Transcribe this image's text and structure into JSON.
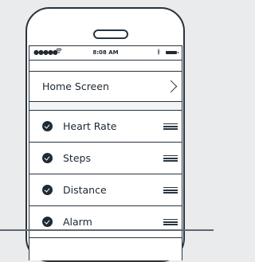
{
  "statusbar": {
    "signal": "●●●●●",
    "time": "8:08 AM",
    "bluetooth": "∦"
  },
  "home": {
    "label": "Home Screen"
  },
  "items": [
    {
      "label": "Heart Rate"
    },
    {
      "label": "Steps"
    },
    {
      "label": "Distance"
    },
    {
      "label": "Alarm"
    }
  ],
  "colors": {
    "ink": "#202a33",
    "background": "#e9ebec",
    "screen": "#ffffff"
  }
}
